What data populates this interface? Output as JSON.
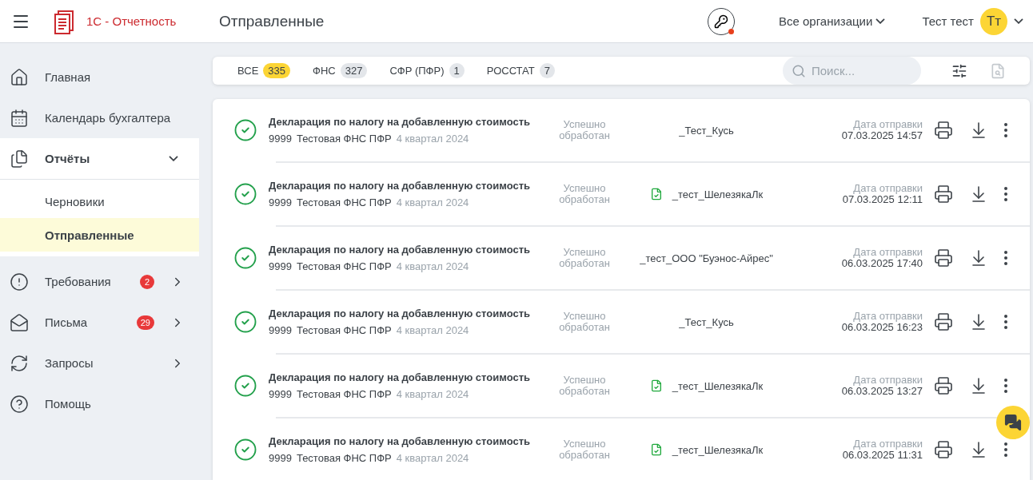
{
  "header": {
    "app_name": "1С - Отчетность",
    "page_title": "Отправленные",
    "organization": "Все организации",
    "user_name": "Тест тест",
    "avatar_initials": "Тт",
    "key_alert": true
  },
  "sidebar": {
    "items": [
      {
        "kind": "item",
        "label": "Главная",
        "selected": false
      },
      {
        "kind": "item",
        "label": "Календарь бухгалтера",
        "selected": false
      },
      {
        "kind": "group",
        "label": "Отчёты",
        "expanded": true,
        "selected": false,
        "children": [
          {
            "label": "Черновики",
            "selected": false
          },
          {
            "label": "Отправленные",
            "selected": true
          }
        ]
      },
      {
        "kind": "link",
        "label": "Требования",
        "badge": "2",
        "selected": false
      },
      {
        "kind": "link",
        "label": "Письма",
        "badge": "29",
        "selected": false
      },
      {
        "kind": "link",
        "label": "Запросы",
        "selected": false
      },
      {
        "kind": "item",
        "label": "Помощь",
        "selected": false
      }
    ]
  },
  "filters": {
    "tabs": [
      {
        "label": "ВСЕ",
        "count": "335",
        "selected": true
      },
      {
        "label": "ФНС",
        "count": "327",
        "selected": false
      },
      {
        "label": "СФР (ПФР)",
        "count": "1",
        "selected": false
      },
      {
        "label": "РОССТАТ",
        "count": "7",
        "selected": false
      }
    ],
    "search": {
      "placeholder": "Поиск..."
    }
  },
  "reports": [
    {
      "title": "Декларация по налогу на добавленную стоимость",
      "code": "9999",
      "recipient": "Тестовая ФНС ПФР",
      "period": "4 квартал 2024",
      "status": "Успешно обработан",
      "organization": "_Тест_Кусь",
      "has_file": false,
      "date_label": "Дата отправки",
      "date": "07.03.2025 14:57"
    },
    {
      "title": "Декларация по налогу на добавленную стоимость",
      "code": "9999",
      "recipient": "Тестовая ФНС ПФР",
      "period": "4 квартал 2024",
      "status": "Успешно обработан",
      "organization": "_тест_ШелезякаЛк",
      "has_file": true,
      "date_label": "Дата отправки",
      "date": "07.03.2025 12:11"
    },
    {
      "title": "Декларация по налогу на добавленную стоимость",
      "code": "9999",
      "recipient": "Тестовая ФНС ПФР",
      "period": "4 квартал 2024",
      "status": "Успешно обработан",
      "organization": "_тест_ООО \"Буэнос-Айрес\"",
      "has_file": false,
      "date_label": "Дата отправки",
      "date": "06.03.2025 17:40"
    },
    {
      "title": "Декларация по налогу на добавленную стоимость",
      "code": "9999",
      "recipient": "Тестовая ФНС ПФР",
      "period": "4 квартал 2024",
      "status": "Успешно обработан",
      "organization": "_Тест_Кусь",
      "has_file": false,
      "date_label": "Дата отправки",
      "date": "06.03.2025 16:23"
    },
    {
      "title": "Декларация по налогу на добавленную стоимость",
      "code": "9999",
      "recipient": "Тестовая ФНС ПФР",
      "period": "4 квартал 2024",
      "status": "Успешно обработан",
      "organization": "_тест_ШелезякаЛк",
      "has_file": true,
      "date_label": "Дата отправки",
      "date": "06.03.2025 13:27"
    },
    {
      "title": "Декларация по налогу на добавленную стоимость",
      "code": "9999",
      "recipient": "Тестовая ФНС ПФР",
      "period": "4 квартал 2024",
      "status": "Успешно обработан",
      "organization": "_тест_ШелезякаЛк",
      "has_file": true,
      "date_label": "Дата отправки",
      "date": "06.03.2025 11:31"
    }
  ]
}
